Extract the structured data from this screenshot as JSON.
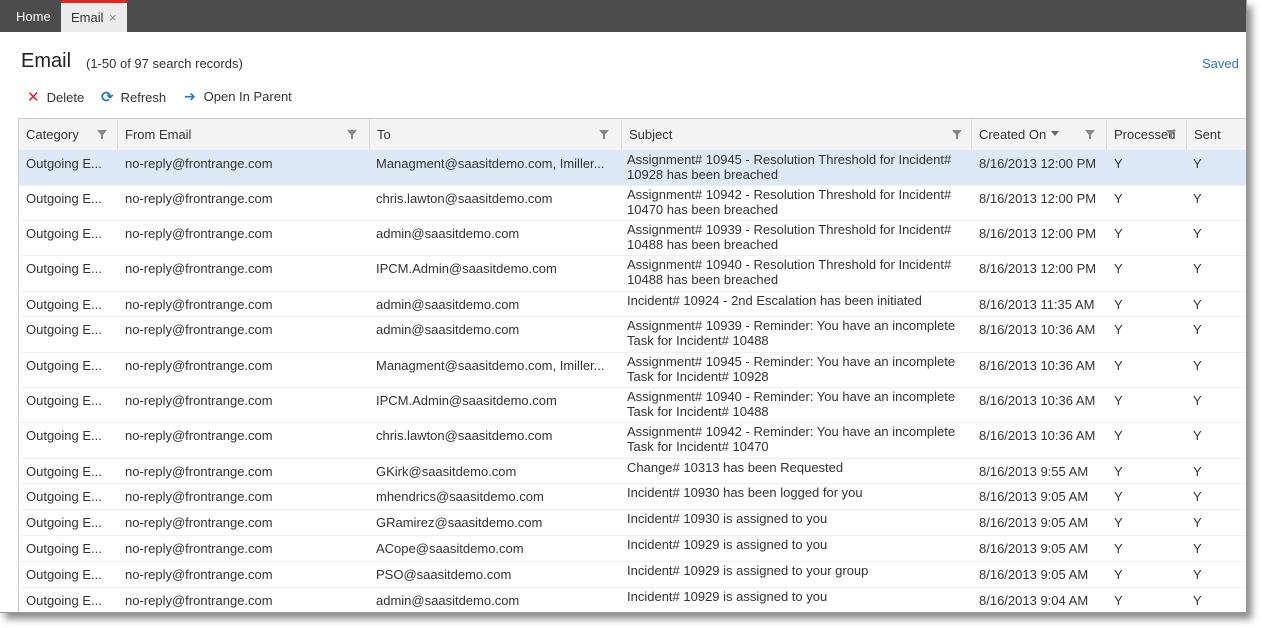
{
  "tabs": [
    {
      "label": "Home"
    },
    {
      "label": "Email",
      "close": "×"
    }
  ],
  "page": {
    "title": "Email",
    "count": "(1-50 of 97 search records)",
    "saved": "Saved"
  },
  "toolbar": {
    "delete": {
      "icon": "✕",
      "label": "Delete"
    },
    "refresh": {
      "icon": "⟳",
      "label": "Refresh"
    },
    "open": {
      "icon": "➔",
      "label": "Open In Parent"
    }
  },
  "columns": [
    "Category",
    "From Email",
    "To",
    "Subject",
    "Created On",
    "Processed",
    "Sent"
  ],
  "rows": [
    {
      "category": "Outgoing E...",
      "from": "no-reply@frontrange.com",
      "to": "Managment@saasitdemo.com, Imiller...",
      "subject": "Assignment# 10945 - Resolution Threshold for Incident# 10928 has been breached",
      "created": "8/16/2013 12:00 PM",
      "processed": "Y",
      "sent": "Y"
    },
    {
      "category": "Outgoing E...",
      "from": "no-reply@frontrange.com",
      "to": "chris.lawton@saasitdemo.com",
      "subject": "Assignment# 10942 - Resolution Threshold for Incident# 10470 has been breached",
      "created": "8/16/2013 12:00 PM",
      "processed": "Y",
      "sent": "Y"
    },
    {
      "category": "Outgoing E...",
      "from": "no-reply@frontrange.com",
      "to": "admin@saasitdemo.com",
      "subject": "Assignment# 10939 - Resolution Threshold for Incident# 10488 has been breached",
      "created": "8/16/2013 12:00 PM",
      "processed": "Y",
      "sent": "Y"
    },
    {
      "category": "Outgoing E...",
      "from": "no-reply@frontrange.com",
      "to": "IPCM.Admin@saasitdemo.com",
      "subject": "Assignment# 10940 - Resolution Threshold for Incident# 10488 has been breached",
      "created": "8/16/2013 12:00 PM",
      "processed": "Y",
      "sent": "Y"
    },
    {
      "category": "Outgoing E...",
      "from": "no-reply@frontrange.com",
      "to": "admin@saasitdemo.com",
      "subject": "Incident# 10924 - 2nd Escalation has been initiated",
      "created": "8/16/2013 11:35 AM",
      "processed": "Y",
      "sent": "Y"
    },
    {
      "category": "Outgoing E...",
      "from": "no-reply@frontrange.com",
      "to": "admin@saasitdemo.com",
      "subject": "Assignment# 10939 - Reminder: You have an incomplete Task for Incident# 10488",
      "created": "8/16/2013 10:36 AM",
      "processed": "Y",
      "sent": "Y"
    },
    {
      "category": "Outgoing E...",
      "from": "no-reply@frontrange.com",
      "to": "Managment@saasitdemo.com, Imiller...",
      "subject": "Assignment# 10945 - Reminder: You have an incomplete Task for Incident# 10928",
      "created": "8/16/2013 10:36 AM",
      "processed": "Y",
      "sent": "Y"
    },
    {
      "category": "Outgoing E...",
      "from": "no-reply@frontrange.com",
      "to": "IPCM.Admin@saasitdemo.com",
      "subject": "Assignment# 10940 - Reminder: You have an incomplete Task for Incident# 10488",
      "created": "8/16/2013 10:36 AM",
      "processed": "Y",
      "sent": "Y"
    },
    {
      "category": "Outgoing E...",
      "from": "no-reply@frontrange.com",
      "to": "chris.lawton@saasitdemo.com",
      "subject": "Assignment# 10942 - Reminder: You have an incomplete Task for Incident# 10470",
      "created": "8/16/2013 10:36 AM",
      "processed": "Y",
      "sent": "Y"
    },
    {
      "category": "Outgoing E...",
      "from": "no-reply@frontrange.com",
      "to": "GKirk@saasitdemo.com",
      "subject": "Change# 10313 has been Requested",
      "created": "8/16/2013 9:55 AM",
      "processed": "Y",
      "sent": "Y"
    },
    {
      "category": "Outgoing E...",
      "from": "no-reply@frontrange.com",
      "to": "mhendrics@saasitdemo.com",
      "subject": "Incident# 10930 has been logged for you",
      "created": "8/16/2013 9:05 AM",
      "processed": "Y",
      "sent": "Y"
    },
    {
      "category": "Outgoing E...",
      "from": "no-reply@frontrange.com",
      "to": "GRamirez@saasitdemo.com",
      "subject": "Incident# 10930 is assigned to you",
      "created": "8/16/2013 9:05 AM",
      "processed": "Y",
      "sent": "Y"
    },
    {
      "category": "Outgoing E...",
      "from": "no-reply@frontrange.com",
      "to": "ACope@saasitdemo.com",
      "subject": "Incident# 10929 is assigned to you",
      "created": "8/16/2013 9:05 AM",
      "processed": "Y",
      "sent": "Y"
    },
    {
      "category": "Outgoing E...",
      "from": "no-reply@frontrange.com",
      "to": "PSO@saasitdemo.com",
      "subject": "Incident# 10929 is assigned to your group",
      "created": "8/16/2013 9:05 AM",
      "processed": "Y",
      "sent": "Y"
    },
    {
      "category": "Outgoing E...",
      "from": "no-reply@frontrange.com",
      "to": "admin@saasitdemo.com",
      "subject": "Incident# 10929 is assigned to you",
      "created": "8/16/2013 9:04 AM",
      "processed": "Y",
      "sent": "Y"
    }
  ],
  "colors": {
    "accent": "#e1261c",
    "link": "#2a76c6",
    "selected_row": "#dde9f7",
    "tabbar": "#4c4c4c"
  }
}
